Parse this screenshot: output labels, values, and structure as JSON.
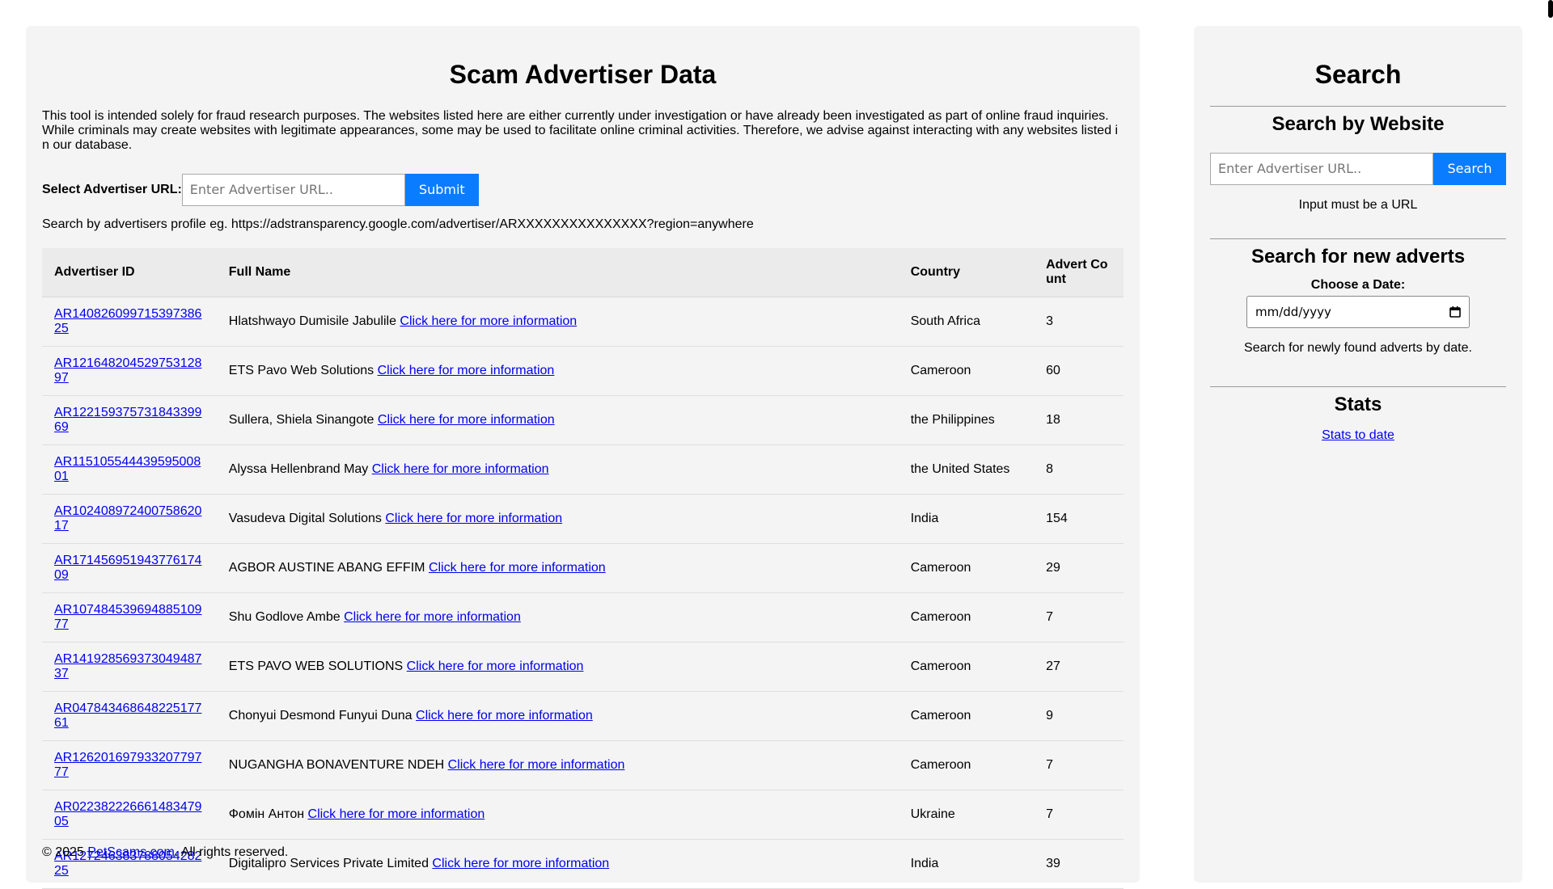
{
  "main": {
    "title": "Scam Advertiser Data",
    "disclaimer": "This tool is intended solely for fraud research purposes. The websites listed here are either currently under investigation or have already been investigated as part of online fraud inquiries. While criminals may create websites with legitimate appearances, some may be used to facilitate online criminal activities. Therefore, we advise against interacting with any websites listed in our database.",
    "select_label": "Select Advertiser URL:",
    "url_placeholder": "Enter Advertiser URL..",
    "submit_label": "Submit",
    "hint": "Search by advertisers profile eg. https://adstransparency.google.com/advertiser/ARXXXXXXXXXXXXXXX?region=anywhere"
  },
  "table": {
    "headers": [
      "Advertiser ID",
      "Full Name",
      "Country",
      "Advert Count"
    ],
    "link_text": "Click here for more information",
    "rows": [
      {
        "id": "AR14082609971539738625",
        "name": "Hlatshwayo Dumisile Jabulile",
        "country": "South Africa",
        "count": "3"
      },
      {
        "id": "AR12164820452975312897",
        "name": "ETS Pavo Web Solutions",
        "country": "Cameroon",
        "count": "60"
      },
      {
        "id": "AR12215937573184339969",
        "name": "Sullera, Shiela Sinangote",
        "country": "the Philippines",
        "count": "18"
      },
      {
        "id": "AR11510554443959500801",
        "name": "Alyssa Hellenbrand May",
        "country": "the United States",
        "count": "8"
      },
      {
        "id": "AR10240897240075862017",
        "name": "Vasudeva Digital Solutions",
        "country": "India",
        "count": "154"
      },
      {
        "id": "AR17145695194377617409",
        "name": "AGBOR AUSTINE ABANG EFFIM",
        "country": "Cameroon",
        "count": "29"
      },
      {
        "id": "AR10748453969488510977",
        "name": "Shu Godlove Ambe",
        "country": "Cameroon",
        "count": "7"
      },
      {
        "id": "AR14192856937304948737",
        "name": "ETS PAVO WEB SOLUTIONS",
        "country": "Cameroon",
        "count": "27"
      },
      {
        "id": "AR04784346864822517761",
        "name": "Chonyui Desmond Funyui Duna",
        "country": "Cameroon",
        "count": "9"
      },
      {
        "id": "AR12620169793320779777",
        "name": "NUGANGHA BONAVENTURE NDEH",
        "country": "Cameroon",
        "count": "7"
      },
      {
        "id": "AR02238222666148347905",
        "name": "Фомін Антон",
        "country": "Ukraine",
        "count": "7"
      },
      {
        "id": "AR12724638378805428225",
        "name": "Digitalipro Services Private Limited",
        "country": "India",
        "count": "39"
      }
    ]
  },
  "footer": {
    "prefix": "© 2025 ",
    "link": "PetScams.com",
    "suffix": ". All rights reserved."
  },
  "sidebar": {
    "title": "Search",
    "website_heading": "Search by Website",
    "website_placeholder": "Enter Advertiser URL..",
    "search_label": "Search",
    "website_note": "Input must be a URL",
    "adverts_heading": "Search for new adverts",
    "date_label": "Choose a Date:",
    "date_placeholder": "mm/dd/yyyy",
    "adverts_note": "Search for newly found adverts by date.",
    "stats_heading": "Stats",
    "stats_link": "Stats to date"
  },
  "icons": {
    "date_picker": "calendar-icon"
  },
  "colors": {
    "accent": "#0a7cff",
    "panel": "#f4f4f4",
    "link": "#0000ee"
  }
}
